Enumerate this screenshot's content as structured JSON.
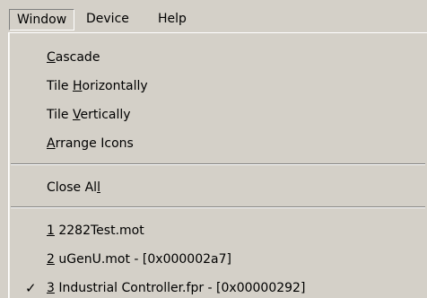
{
  "menubar": {
    "items": [
      {
        "label": "Window"
      },
      {
        "label": "Device"
      },
      {
        "label": "Help"
      }
    ]
  },
  "window_menu": {
    "group1": [
      {
        "pre": "",
        "mnemonic": "C",
        "post": "ascade"
      },
      {
        "pre": "Tile ",
        "mnemonic": "H",
        "post": "orizontally"
      },
      {
        "pre": "Tile ",
        "mnemonic": "V",
        "post": "ertically"
      },
      {
        "pre": "",
        "mnemonic": "A",
        "post": "rrange Icons"
      }
    ],
    "close_all": {
      "pre": "Close Al",
      "mnemonic": "l",
      "post": ""
    },
    "windows": [
      {
        "mnemonic": "1",
        "post": " 2282Test.mot",
        "checked": false
      },
      {
        "mnemonic": "2",
        "post": " uGenU.mot - [0x000002a7]",
        "checked": false
      },
      {
        "mnemonic": "3",
        "post": " Industrial Controller.fpr - [0x00000292]",
        "checked": true,
        "check_glyph": "✓"
      }
    ]
  }
}
